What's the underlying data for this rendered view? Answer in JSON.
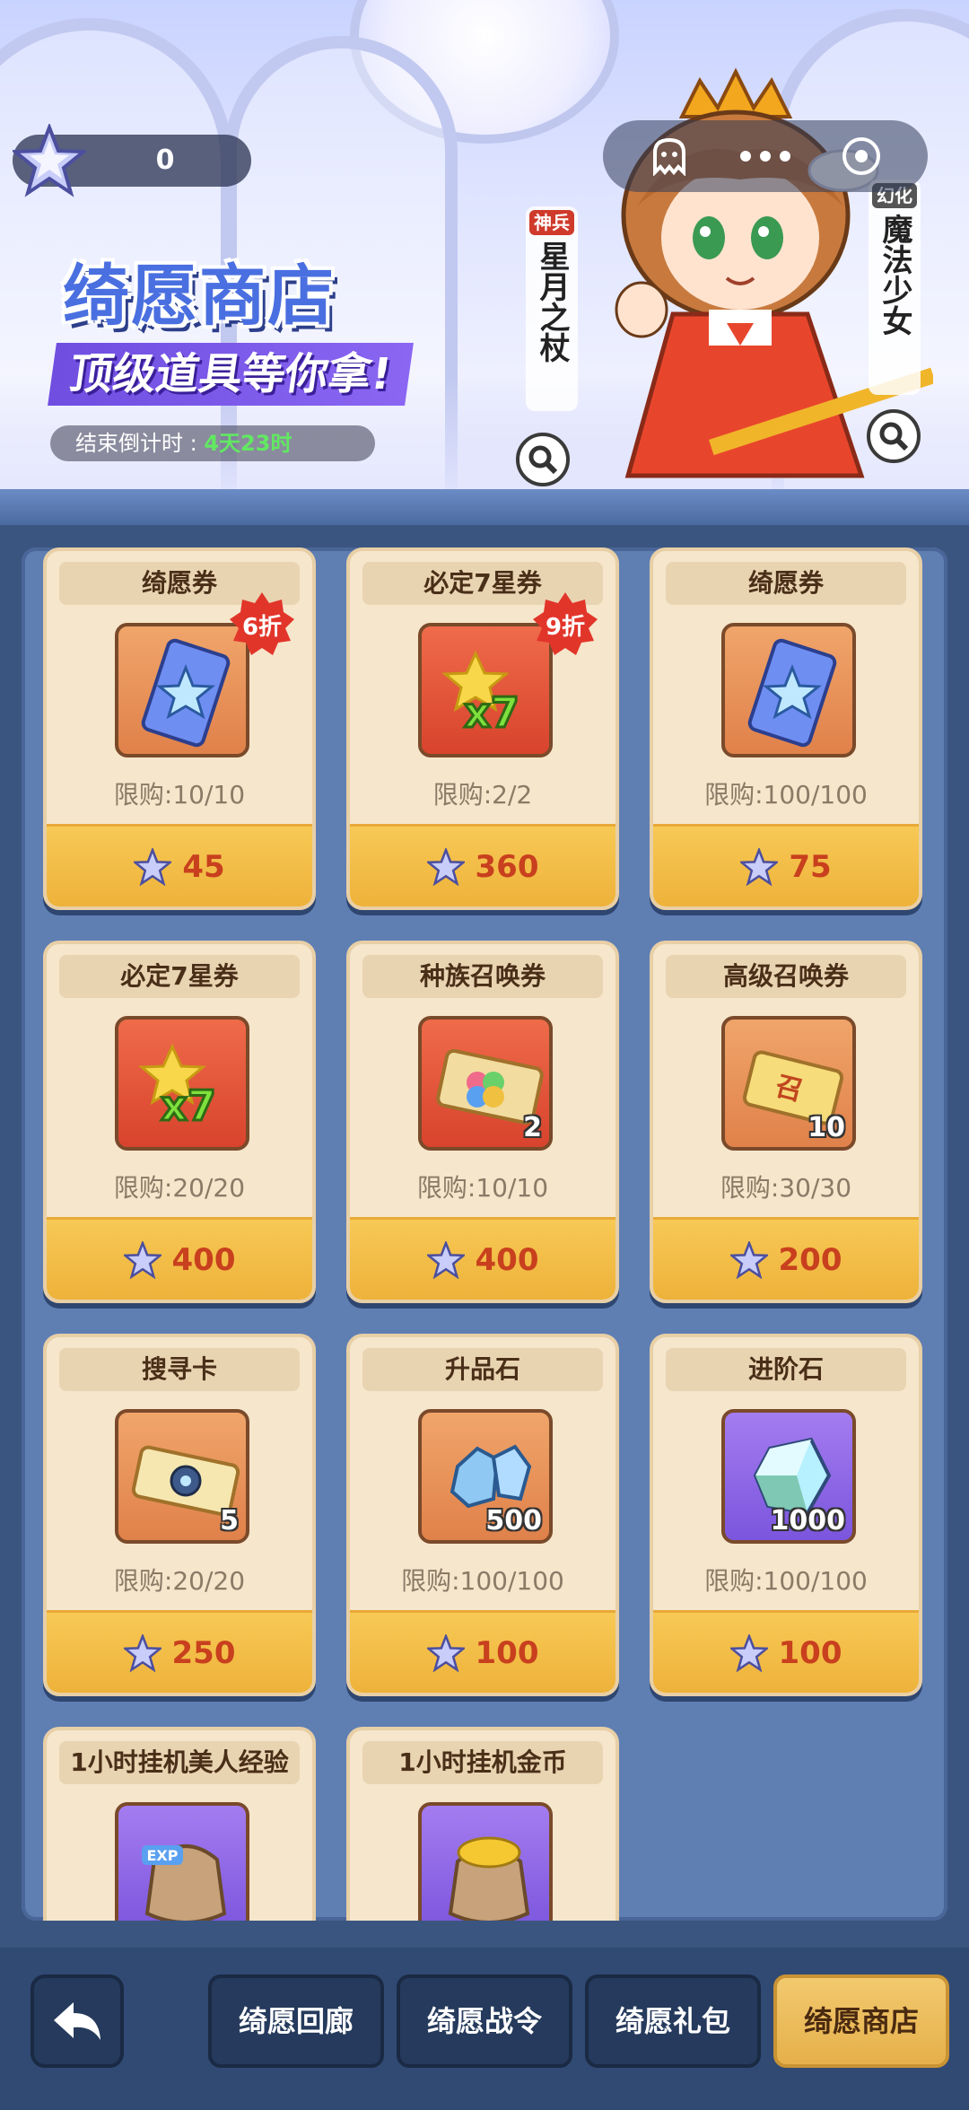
{
  "currency": {
    "amount": "0"
  },
  "header": {
    "title": "绮愿商店",
    "subtitle": "顶级道具等你拿!",
    "countdown_label": "结束倒计时 : ",
    "countdown_value": "4天23时"
  },
  "tags": {
    "weapon": {
      "badge": "神兵",
      "name": "星月之杖"
    },
    "transform": {
      "badge": "幻化",
      "name": "魔法少女"
    }
  },
  "items": [
    {
      "name": "绮愿券",
      "limit": "限购:10/10",
      "price": "45",
      "discount": "6折",
      "qty": ""
    },
    {
      "name": "必定7星券",
      "limit": "限购:2/2",
      "price": "360",
      "discount": "9折",
      "qty": ""
    },
    {
      "name": "绮愿券",
      "limit": "限购:100/100",
      "price": "75",
      "discount": "",
      "qty": ""
    },
    {
      "name": "必定7星券",
      "limit": "限购:20/20",
      "price": "400",
      "discount": "",
      "qty": ""
    },
    {
      "name": "种族召唤券",
      "limit": "限购:10/10",
      "price": "400",
      "discount": "",
      "qty": "2"
    },
    {
      "name": "高级召唤券",
      "limit": "限购:30/30",
      "price": "200",
      "discount": "",
      "qty": "10"
    },
    {
      "name": "搜寻卡",
      "limit": "限购:20/20",
      "price": "250",
      "discount": "",
      "qty": "5"
    },
    {
      "name": "升品石",
      "limit": "限购:100/100",
      "price": "100",
      "discount": "",
      "qty": "500"
    },
    {
      "name": "进阶石",
      "limit": "限购:100/100",
      "price": "100",
      "discount": "",
      "qty": "1000"
    },
    {
      "name": "1小时挂机美人经验",
      "limit": "",
      "price": "",
      "discount": "",
      "qty": ""
    },
    {
      "name": "1小时挂机金币",
      "limit": "",
      "price": "",
      "discount": "",
      "qty": ""
    }
  ],
  "nav": {
    "gallery": "绮愿回廊",
    "pass": "绮愿战令",
    "gift": "绮愿礼包",
    "shop": "绮愿商店"
  },
  "icons": {
    "currency": "star-gem-icon",
    "back": "back-arrow-icon",
    "search": "magnifier-icon"
  },
  "colors": {
    "price_bar": "#f2c04a",
    "price_text": "#c8401e",
    "active_tab": "#e9b552",
    "panel": "#5f7fb3"
  }
}
